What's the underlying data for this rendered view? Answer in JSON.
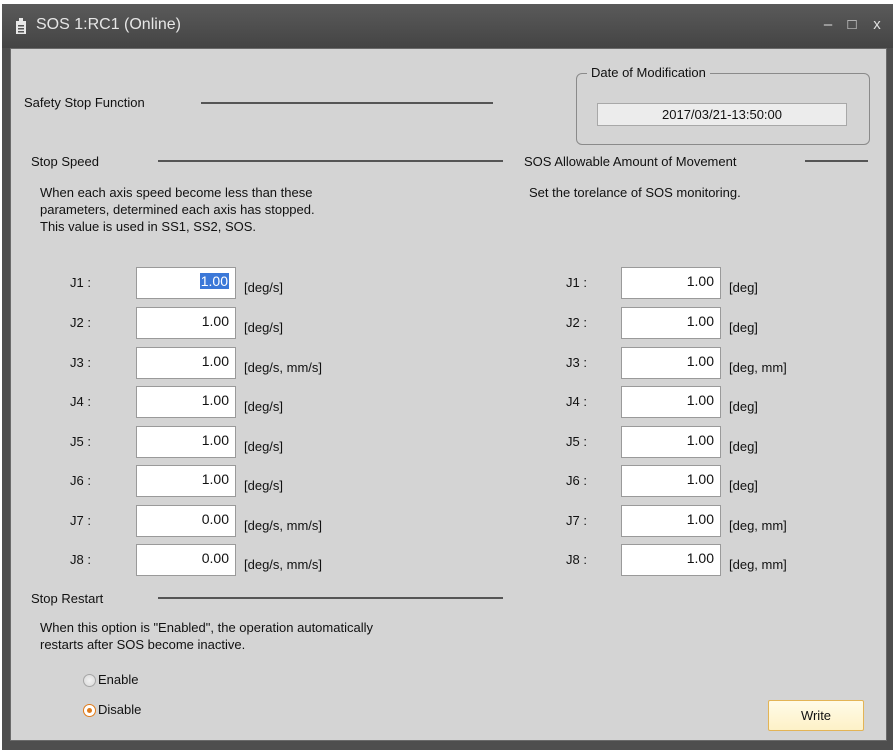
{
  "window": {
    "title": "SOS 1:RC1 (Online)",
    "minimize_glyph": "–",
    "maximize_glyph": "□",
    "close_glyph": "x"
  },
  "safety_stop": {
    "label": "Safety Stop Function"
  },
  "date_of_modification": {
    "label": "Date of Modification",
    "value": "2017/03/21-13:50:00"
  },
  "stop_speed": {
    "label": "Stop Speed",
    "desc1": "When each axis speed become less than these",
    "desc2": "parameters, determined each axis has stopped.",
    "desc3": "This value is used in SS1, SS2, SOS.",
    "rows": [
      {
        "label": "J1 :",
        "value": "1.00",
        "unit": "[deg/s]"
      },
      {
        "label": "J2 :",
        "value": "1.00",
        "unit": "[deg/s]"
      },
      {
        "label": "J3 :",
        "value": "1.00",
        "unit": "[deg/s, mm/s]"
      },
      {
        "label": "J4 :",
        "value": "1.00",
        "unit": "[deg/s]"
      },
      {
        "label": "J5 :",
        "value": "1.00",
        "unit": "[deg/s]"
      },
      {
        "label": "J6 :",
        "value": "1.00",
        "unit": "[deg/s]"
      },
      {
        "label": "J7 :",
        "value": "0.00",
        "unit": "[deg/s, mm/s]"
      },
      {
        "label": "J8 :",
        "value": "0.00",
        "unit": "[deg/s, mm/s]"
      }
    ]
  },
  "sos_movement": {
    "label": "SOS Allowable Amount of Movement",
    "desc": "Set the torelance of SOS monitoring.",
    "rows": [
      {
        "label": "J1 :",
        "value": "1.00",
        "unit": "[deg]"
      },
      {
        "label": "J2 :",
        "value": "1.00",
        "unit": "[deg]"
      },
      {
        "label": "J3 :",
        "value": "1.00",
        "unit": "[deg, mm]"
      },
      {
        "label": "J4 :",
        "value": "1.00",
        "unit": "[deg]"
      },
      {
        "label": "J5 :",
        "value": "1.00",
        "unit": "[deg]"
      },
      {
        "label": "J6 :",
        "value": "1.00",
        "unit": "[deg]"
      },
      {
        "label": "J7 :",
        "value": "1.00",
        "unit": "[deg, mm]"
      },
      {
        "label": "J8 :",
        "value": "1.00",
        "unit": "[deg, mm]"
      }
    ]
  },
  "stop_restart": {
    "label": "Stop Restart",
    "desc1": "When this option is \"Enabled\", the operation automatically",
    "desc2": "restarts after SOS become inactive.",
    "enable_label": "Enable",
    "disable_label": "Disable",
    "selected": "Disable"
  },
  "write_button": {
    "label": "Write"
  },
  "colors": {
    "panel_bg": "#d4d4d4",
    "titlebar_bg": "#4e4e4e",
    "accent_orange": "#e07b1a",
    "button_border": "#e3b456",
    "selection_blue": "#3b78d8"
  }
}
